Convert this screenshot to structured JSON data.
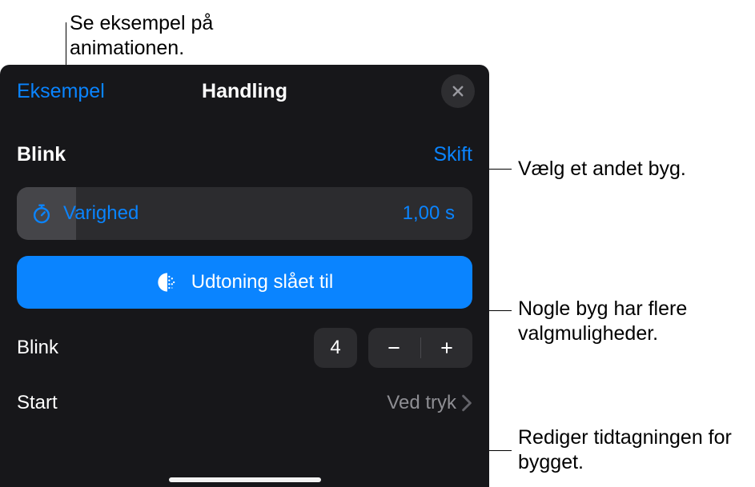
{
  "callouts": {
    "preview": "Se eksempel på animationen.",
    "change": "Vælg et andet byg.",
    "options": "Nogle byg har flere valgmuligheder.",
    "timing": "Rediger tidtagningen for bygget."
  },
  "header": {
    "preview_button": "Eksempel",
    "title": "Handling"
  },
  "effect": {
    "name": "Blink",
    "change_button": "Skift"
  },
  "duration": {
    "label": "Varighed",
    "value": "1,00 s"
  },
  "fade_toggle": {
    "label": "Udtoning slået til"
  },
  "count": {
    "label": "Blink",
    "value": "4"
  },
  "start": {
    "label": "Start",
    "value": "Ved tryk"
  }
}
